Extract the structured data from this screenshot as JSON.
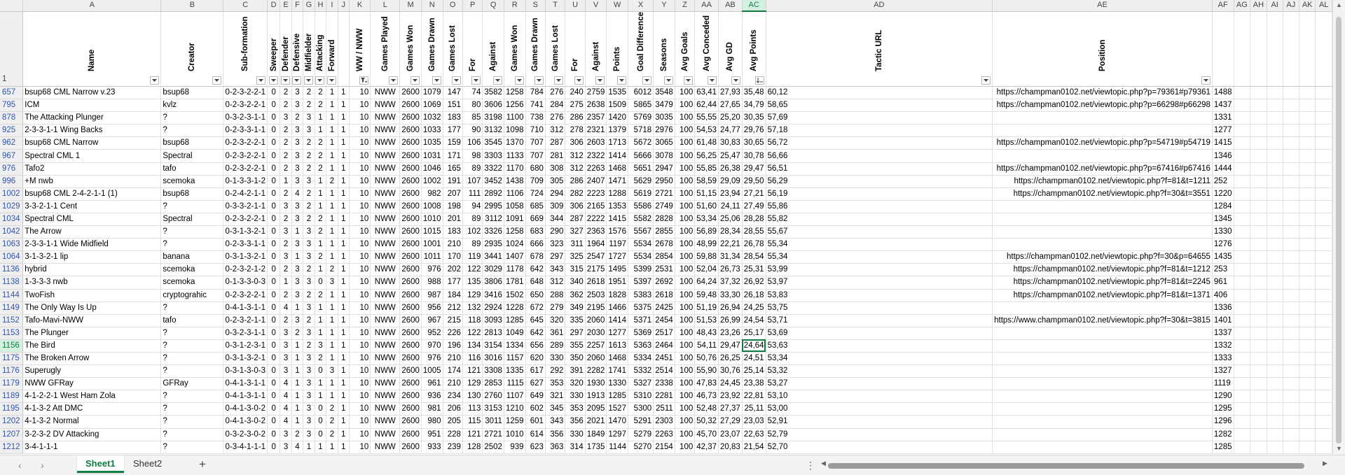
{
  "column_letters": [
    "A",
    "B",
    "C",
    "D",
    "E",
    "F",
    "G",
    "H",
    "I",
    "J",
    "K",
    "L",
    "M",
    "N",
    "O",
    "P",
    "Q",
    "R",
    "S",
    "T",
    "U",
    "V",
    "W",
    "X",
    "Y",
    "Z",
    "AA",
    "AB",
    "AC",
    "AD",
    "AE",
    "AF",
    "AG",
    "AH",
    "AI",
    "AJ",
    "AK",
    "AL"
  ],
  "header_row_number": "1",
  "headers": [
    "Name",
    "Creator",
    "Sub-formation",
    "Sweeper",
    "Defender",
    "Defensive",
    "Midfielder",
    "Attacking",
    "Forward",
    "",
    "WW / NWW",
    "Games Played",
    "Games Won",
    "Games Drawn",
    "Games Lost",
    "For",
    "Against",
    "Games Won",
    "Games Drawn",
    "Games Lost",
    "For",
    "Against",
    "Points",
    "Goal Difference",
    "Seasons",
    "Avg Goals",
    "Avg Conceded",
    "Avg GD",
    "Avg Points",
    "Tactic URL",
    "Position"
  ],
  "selected_cell": "AC1156",
  "rows": [
    [
      "657",
      "bsup68 CML Narrow v.23",
      "bsup68",
      "0-2-3-2-2-1",
      "0",
      "2",
      "3",
      "2",
      "2",
      "1",
      "1",
      "10",
      "NWW",
      "2600",
      "1079",
      "147",
      "74",
      "3582",
      "1258",
      "784",
      "276",
      "240",
      "2759",
      "1535",
      "6012",
      "3548",
      "100",
      "63,41",
      "27,93",
      "35,48",
      "60,12",
      "https://champman0102.net/viewtopic.php?p=79361#p79361",
      "1488"
    ],
    [
      "795",
      "ICM",
      "kvlz",
      "0-2-3-2-2-1",
      "0",
      "2",
      "3",
      "2",
      "2",
      "1",
      "1",
      "10",
      "NWW",
      "2600",
      "1069",
      "151",
      "80",
      "3606",
      "1256",
      "741",
      "284",
      "275",
      "2638",
      "1509",
      "5865",
      "3479",
      "100",
      "62,44",
      "27,65",
      "34,79",
      "58,65",
      "https://champman0102.net/viewtopic.php?p=66298#p66298",
      "1437"
    ],
    [
      "878",
      "The Attacking Plunger",
      "?",
      "0-3-2-3-1-1",
      "0",
      "3",
      "2",
      "3",
      "1",
      "1",
      "1",
      "10",
      "NWW",
      "2600",
      "1032",
      "183",
      "85",
      "3198",
      "1100",
      "738",
      "276",
      "286",
      "2357",
      "1420",
      "5769",
      "3035",
      "100",
      "55,55",
      "25,20",
      "30,35",
      "57,69",
      "",
      "1331"
    ],
    [
      "925",
      "2-3-3-1-1 Wing Backs",
      "?",
      "0-2-3-3-1-1",
      "0",
      "2",
      "3",
      "3",
      "1",
      "1",
      "1",
      "10",
      "NWW",
      "2600",
      "1033",
      "177",
      "90",
      "3132",
      "1098",
      "710",
      "312",
      "278",
      "2321",
      "1379",
      "5718",
      "2976",
      "100",
      "54,53",
      "24,77",
      "29,76",
      "57,18",
      "",
      "1277"
    ],
    [
      "962",
      "bsup68 CML Narrow",
      "bsup68",
      "0-2-3-2-2-1",
      "0",
      "2",
      "3",
      "2",
      "2",
      "1",
      "1",
      "10",
      "NWW",
      "2600",
      "1035",
      "159",
      "106",
      "3545",
      "1370",
      "707",
      "287",
      "306",
      "2603",
      "1713",
      "5672",
      "3065",
      "100",
      "61,48",
      "30,83",
      "30,65",
      "56,72",
      "https://champman0102.net/viewtopic.php?p=54719#p54719",
      "1415"
    ],
    [
      "967",
      "Spectral CML 1",
      "Spectral",
      "0-2-3-2-2-1",
      "0",
      "2",
      "3",
      "2",
      "2",
      "1",
      "1",
      "10",
      "NWW",
      "2600",
      "1031",
      "171",
      "98",
      "3303",
      "1133",
      "707",
      "281",
      "312",
      "2322",
      "1414",
      "5666",
      "3078",
      "100",
      "56,25",
      "25,47",
      "30,78",
      "56,66",
      "",
      "1346"
    ],
    [
      "976",
      "Tafo2",
      "tafo",
      "0-2-3-2-2-1",
      "0",
      "2",
      "3",
      "2",
      "2",
      "1",
      "1",
      "10",
      "NWW",
      "2600",
      "1046",
      "165",
      "89",
      "3322",
      "1170",
      "680",
      "308",
      "312",
      "2263",
      "1468",
      "5651",
      "2947",
      "100",
      "55,85",
      "26,38",
      "29,47",
      "56,51",
      "https://champman0102.net/viewtopic.php?p=67416#p67416",
      "1444"
    ],
    [
      "996",
      "+M nwb",
      "scemoka",
      "0-1-3-3-1-2",
      "0",
      "1",
      "3",
      "3",
      "1",
      "2",
      "1",
      "10",
      "NWW",
      "2600",
      "1002",
      "191",
      "107",
      "3452",
      "1438",
      "709",
      "305",
      "286",
      "2407",
      "1471",
      "5629",
      "2950",
      "100",
      "58,59",
      "29,09",
      "29,50",
      "56,29",
      "https://champman0102.net/viewtopic.php?f=81&t=1211",
      "252"
    ],
    [
      "1002",
      "bsup68 CML 2-4-2-1-1 (1)",
      "bsup68",
      "0-2-4-2-1-1",
      "0",
      "2",
      "4",
      "2",
      "1",
      "1",
      "1",
      "10",
      "NWW",
      "2600",
      "982",
      "207",
      "111",
      "2892",
      "1106",
      "724",
      "294",
      "282",
      "2223",
      "1288",
      "5619",
      "2721",
      "100",
      "51,15",
      "23,94",
      "27,21",
      "56,19",
      "https://champman0102.net/viewtopic.php?f=30&t=3551",
      "1220"
    ],
    [
      "1029",
      "3-3-2-1-1 Cent",
      "?",
      "0-3-3-2-1-1",
      "0",
      "3",
      "3",
      "2",
      "1",
      "1",
      "1",
      "10",
      "NWW",
      "2600",
      "1008",
      "198",
      "94",
      "2995",
      "1058",
      "685",
      "309",
      "306",
      "2165",
      "1353",
      "5586",
      "2749",
      "100",
      "51,60",
      "24,11",
      "27,49",
      "55,86",
      "",
      "1284"
    ],
    [
      "1034",
      "Spectral CML",
      "Spectral",
      "0-2-3-2-2-1",
      "0",
      "2",
      "3",
      "2",
      "2",
      "1",
      "1",
      "10",
      "NWW",
      "2600",
      "1010",
      "201",
      "89",
      "3112",
      "1091",
      "669",
      "344",
      "287",
      "2222",
      "1415",
      "5582",
      "2828",
      "100",
      "53,34",
      "25,06",
      "28,28",
      "55,82",
      "",
      "1345"
    ],
    [
      "1042",
      "The Arrow",
      "?",
      "0-3-1-3-2-1",
      "0",
      "3",
      "1",
      "3",
      "2",
      "1",
      "1",
      "10",
      "NWW",
      "2600",
      "1015",
      "183",
      "102",
      "3326",
      "1258",
      "683",
      "290",
      "327",
      "2363",
      "1576",
      "5567",
      "2855",
      "100",
      "56,89",
      "28,34",
      "28,55",
      "55,67",
      "",
      "1330"
    ],
    [
      "1063",
      "2-3-3-1-1 Wide Midfield",
      "?",
      "0-2-3-3-1-1",
      "0",
      "2",
      "3",
      "3",
      "1",
      "1",
      "1",
      "10",
      "NWW",
      "2600",
      "1001",
      "210",
      "89",
      "2935",
      "1024",
      "666",
      "323",
      "311",
      "1964",
      "1197",
      "5534",
      "2678",
      "100",
      "48,99",
      "22,21",
      "26,78",
      "55,34",
      "",
      "1276"
    ],
    [
      "1064",
      "3-1-3-2-1 lip",
      "banana",
      "0-3-1-3-2-1",
      "0",
      "3",
      "1",
      "3",
      "2",
      "1",
      "1",
      "10",
      "NWW",
      "2600",
      "1011",
      "170",
      "119",
      "3441",
      "1407",
      "678",
      "297",
      "325",
      "2547",
      "1727",
      "5534",
      "2854",
      "100",
      "59,88",
      "31,34",
      "28,54",
      "55,34",
      "https://champman0102.net/viewtopic.php?f=30&p=64655",
      "1435"
    ],
    [
      "1136",
      "hybrid",
      "scemoka",
      "0-2-3-2-1-2",
      "0",
      "2",
      "3",
      "2",
      "1",
      "2",
      "1",
      "10",
      "NWW",
      "2600",
      "976",
      "202",
      "122",
      "3029",
      "1178",
      "642",
      "343",
      "315",
      "2175",
      "1495",
      "5399",
      "2531",
      "100",
      "52,04",
      "26,73",
      "25,31",
      "53,99",
      "https://champman0102.net/viewtopic.php?f=81&t=1212",
      "253"
    ],
    [
      "1138",
      "1-3-3-3 nwb",
      "scemoka",
      "0-1-3-3-0-3",
      "0",
      "1",
      "3",
      "3",
      "0",
      "3",
      "1",
      "10",
      "NWW",
      "2600",
      "988",
      "177",
      "135",
      "3806",
      "1781",
      "648",
      "312",
      "340",
      "2618",
      "1951",
      "5397",
      "2692",
      "100",
      "64,24",
      "37,32",
      "26,92",
      "53,97",
      "https://champman0102.net/viewtopic.php?f=81&t=2245",
      "961"
    ],
    [
      "1144",
      "TwoFish",
      "cryptograhic",
      "0-2-3-2-2-1",
      "0",
      "2",
      "3",
      "2",
      "2",
      "1",
      "1",
      "10",
      "NWW",
      "2600",
      "987",
      "184",
      "129",
      "3416",
      "1502",
      "650",
      "288",
      "362",
      "2503",
      "1828",
      "5383",
      "2618",
      "100",
      "59,48",
      "33,30",
      "26,18",
      "53,83",
      "https://champman0102.net/viewtopic.php?f=81&t=1371",
      "406"
    ],
    [
      "1149",
      "The Only Way Is Up",
      "?",
      "0-4-1-3-1-1",
      "0",
      "4",
      "1",
      "3",
      "1",
      "1",
      "1",
      "10",
      "NWW",
      "2600",
      "956",
      "212",
      "132",
      "2924",
      "1228",
      "672",
      "279",
      "349",
      "2195",
      "1466",
      "5375",
      "2425",
      "100",
      "51,19",
      "26,94",
      "24,25",
      "53,75",
      "",
      "1336"
    ],
    [
      "1152",
      "Tafo-Mavi-NWW",
      "tafo",
      "0-2-3-2-1-1",
      "0",
      "2",
      "3",
      "2",
      "1",
      "1",
      "1",
      "10",
      "NWW",
      "2600",
      "967",
      "215",
      "118",
      "3093",
      "1285",
      "645",
      "320",
      "335",
      "2060",
      "1414",
      "5371",
      "2454",
      "100",
      "51,53",
      "26,99",
      "24,54",
      "53,71",
      "https://www.champman0102.net/viewtopic.php?f=30&t=3815",
      "1401"
    ],
    [
      "1153",
      "The Plunger",
      "?",
      "0-3-2-3-1-1",
      "0",
      "3",
      "2",
      "3",
      "1",
      "1",
      "1",
      "10",
      "NWW",
      "2600",
      "952",
      "226",
      "122",
      "2813",
      "1049",
      "642",
      "361",
      "297",
      "2030",
      "1277",
      "5369",
      "2517",
      "100",
      "48,43",
      "23,26",
      "25,17",
      "53,69",
      "",
      "1337"
    ],
    [
      "1156",
      "The Bird",
      "?",
      "0-3-1-2-3-1",
      "0",
      "3",
      "1",
      "2",
      "3",
      "1",
      "1",
      "10",
      "NWW",
      "2600",
      "970",
      "196",
      "134",
      "3154",
      "1334",
      "656",
      "289",
      "355",
      "2257",
      "1613",
      "5363",
      "2464",
      "100",
      "54,11",
      "29,47",
      "24,64",
      "53,63",
      "",
      "1332"
    ],
    [
      "1175",
      "The Broken Arrow",
      "?",
      "0-3-1-3-2-1",
      "0",
      "3",
      "1",
      "3",
      "2",
      "1",
      "1",
      "10",
      "NWW",
      "2600",
      "976",
      "210",
      "116",
      "3016",
      "1157",
      "620",
      "330",
      "350",
      "2060",
      "1468",
      "5334",
      "2451",
      "100",
      "50,76",
      "26,25",
      "24,51",
      "53,34",
      "",
      "1333"
    ],
    [
      "1176",
      "Superugly",
      "?",
      "0-3-1-3-0-3",
      "0",
      "3",
      "1",
      "3",
      "0",
      "3",
      "1",
      "10",
      "NWW",
      "2600",
      "1005",
      "174",
      "121",
      "3308",
      "1335",
      "617",
      "292",
      "391",
      "2282",
      "1741",
      "5332",
      "2514",
      "100",
      "55,90",
      "30,76",
      "25,14",
      "53,32",
      "",
      "1327"
    ],
    [
      "1179",
      "NWW GFRay",
      "GFRay",
      "0-4-1-3-1-1",
      "0",
      "4",
      "1",
      "3",
      "1",
      "1",
      "1",
      "10",
      "NWW",
      "2600",
      "961",
      "210",
      "129",
      "2853",
      "1115",
      "627",
      "353",
      "320",
      "1930",
      "1330",
      "5327",
      "2338",
      "100",
      "47,83",
      "24,45",
      "23,38",
      "53,27",
      "",
      "1119"
    ],
    [
      "1189",
      "4-1-2-2-1 West Ham Zola",
      "?",
      "0-4-1-3-1-1",
      "0",
      "4",
      "1",
      "3",
      "1",
      "1",
      "1",
      "10",
      "NWW",
      "2600",
      "936",
      "234",
      "130",
      "2760",
      "1107",
      "649",
      "321",
      "330",
      "1913",
      "1285",
      "5310",
      "2281",
      "100",
      "46,73",
      "23,92",
      "22,81",
      "53,10",
      "",
      "1290"
    ],
    [
      "1195",
      "4-1-3-2 Att DMC",
      "?",
      "0-4-1-3-0-2",
      "0",
      "4",
      "1",
      "3",
      "0",
      "2",
      "1",
      "10",
      "NWW",
      "2600",
      "981",
      "206",
      "113",
      "3153",
      "1210",
      "602",
      "345",
      "353",
      "2095",
      "1527",
      "5300",
      "2511",
      "100",
      "52,48",
      "27,37",
      "25,11",
      "53,00",
      "",
      "1295"
    ],
    [
      "1202",
      "4-1-3-2 Normal",
      "?",
      "0-4-1-3-0-2",
      "0",
      "4",
      "1",
      "3",
      "0",
      "2",
      "1",
      "10",
      "NWW",
      "2600",
      "980",
      "205",
      "115",
      "3011",
      "1259",
      "601",
      "343",
      "356",
      "2021",
      "1470",
      "5291",
      "2303",
      "100",
      "50,32",
      "27,29",
      "23,03",
      "52,91",
      "",
      "1296"
    ],
    [
      "1207",
      "3-2-3-2 DV Attacking",
      "?",
      "0-3-2-3-0-2",
      "0",
      "3",
      "2",
      "3",
      "0",
      "2",
      "1",
      "10",
      "NWW",
      "2600",
      "951",
      "228",
      "121",
      "2721",
      "1010",
      "614",
      "356",
      "330",
      "1849",
      "1297",
      "5279",
      "2263",
      "100",
      "45,70",
      "23,07",
      "22,63",
      "52,79",
      "",
      "1282"
    ],
    [
      "1212",
      "3-4-1-1-1",
      "?",
      "0-3-4-1-1-1",
      "0",
      "3",
      "4",
      "1",
      "1",
      "1",
      "1",
      "10",
      "NWW",
      "2600",
      "933",
      "239",
      "128",
      "2502",
      "939",
      "623",
      "363",
      "314",
      "1735",
      "1144",
      "5270",
      "2154",
      "100",
      "42,37",
      "20,83",
      "21,54",
      "52,70",
      "",
      "1285"
    ]
  ],
  "tabs": {
    "sheet1": "Sheet1",
    "sheet2": "Sheet2"
  },
  "icons": {
    "add_sheet": "plus-icon",
    "nav_prev": "chevron-left-icon",
    "nav_next": "chevron-right-icon",
    "filter": "filter-dropdown-icon",
    "more": "vertical-ellipsis-icon"
  },
  "colors": {
    "accent": "#107c41",
    "row_number": "#3355aa"
  }
}
